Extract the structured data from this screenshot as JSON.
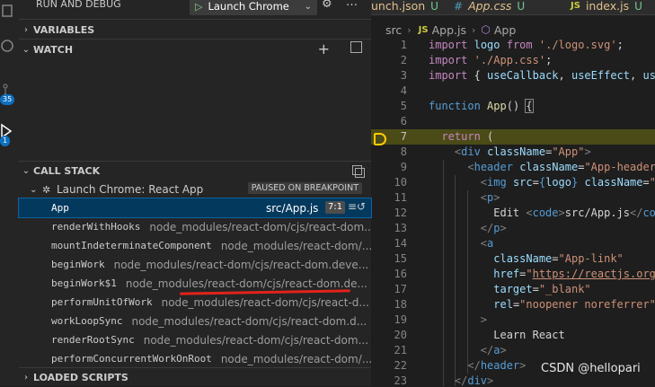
{
  "activity_bar": {
    "badge_count": "35",
    "debug_badge": "1"
  },
  "run_debug": {
    "title": "RUN AND DEBUG",
    "launch_config": "Launch Chrome"
  },
  "sections": {
    "variables": "VARIABLES",
    "watch": "WATCH",
    "call_stack": "CALL STACK",
    "loaded_scripts": "LOADED SCRIPTS"
  },
  "call_stack": {
    "thread": "Launch Chrome: React App",
    "status": "PAUSED ON BREAKPOINT",
    "frames": [
      {
        "name": "App",
        "source": "src/App.js",
        "position": "7:1"
      },
      {
        "name": "renderWithHooks",
        "source": "node_modules/react-dom/cjs/react-dom..."
      },
      {
        "name": "mountIndeterminateComponent",
        "source": "node_modules/react-dom/..."
      },
      {
        "name": "beginWork",
        "source": "node_modules/react-dom/cjs/react-dom.deve..."
      },
      {
        "name": "beginWork$1",
        "source": "node_modules/react-dom/cjs/react-dom.de..."
      },
      {
        "name": "performUnitOfWork",
        "source": "node_modules/react-dom/cjs/react-d..."
      },
      {
        "name": "workLoopSync",
        "source": "node_modules/react-dom/cjs/react-dom.d..."
      },
      {
        "name": "renderRootSync",
        "source": "node_modules/react-dom/cjs/react-dom..."
      },
      {
        "name": "performConcurrentWorkOnRoot",
        "source": "node_modules/react-dom/..."
      }
    ]
  },
  "tabs": [
    {
      "name": "unch.json",
      "status": "U",
      "type": "json"
    },
    {
      "name": "App.css",
      "status": "U",
      "type": "css"
    },
    {
      "name": "index.js",
      "status": "U",
      "type": "js"
    }
  ],
  "breadcrumb": {
    "folder": "src",
    "file": "App.js",
    "symbol": "App"
  },
  "editor": {
    "current_line": 7,
    "lines": [
      {
        "n": "1"
      },
      {
        "n": "2"
      },
      {
        "n": "3"
      },
      {
        "n": "4"
      },
      {
        "n": "5"
      },
      {
        "n": "6"
      },
      {
        "n": "7"
      },
      {
        "n": "8"
      },
      {
        "n": "9"
      },
      {
        "n": "10"
      },
      {
        "n": "11"
      },
      {
        "n": "12"
      },
      {
        "n": "13"
      },
      {
        "n": "14"
      },
      {
        "n": "15"
      },
      {
        "n": "16"
      },
      {
        "n": "17"
      },
      {
        "n": "18"
      },
      {
        "n": "19"
      },
      {
        "n": "20"
      },
      {
        "n": "21"
      },
      {
        "n": "22"
      },
      {
        "n": "23"
      }
    ]
  },
  "watermark": "CSDN @hellopari",
  "colors": {
    "accent": "#0e639c",
    "breakpoint_line": "#4b4b18",
    "breakpoint_arrow": "#ffcc00",
    "annotation_line": "#e2231a"
  }
}
